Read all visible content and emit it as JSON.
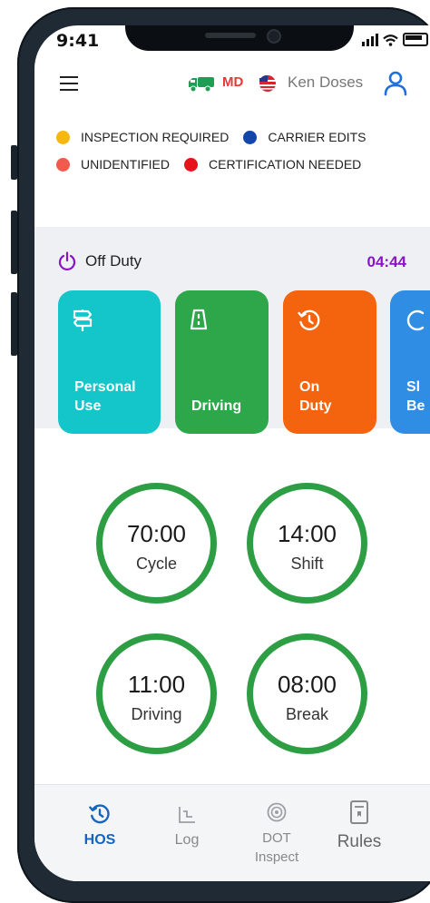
{
  "status_bar": {
    "time": "9:41"
  },
  "header": {
    "jurisdiction": "MD",
    "driver_name": "Ken Doses"
  },
  "legend": [
    {
      "label": "INSPECTION REQUIRED",
      "color": "#f6b80e"
    },
    {
      "label": "CARRIER EDITS",
      "color": "#1346a8"
    },
    {
      "label": "UNIDENTIFIED",
      "color": "#f25a4e"
    },
    {
      "label": "CERTIFICATION NEEDED",
      "color": "#e8121a"
    }
  ],
  "duty": {
    "status": "Off Duty",
    "timer": "04:44",
    "accent": "#8a12c8"
  },
  "duty_buttons": [
    {
      "line1": "Personal",
      "line2": "Use",
      "color": "#14c6c9",
      "icon": "signpost-icon"
    },
    {
      "line1": "",
      "line2": "Driving",
      "color": "#2ea74a",
      "icon": "road-icon"
    },
    {
      "line1": "On",
      "line2": "Duty",
      "color": "#f4640e",
      "icon": "clock-rotate-icon"
    },
    {
      "line1": "Sl",
      "line2": "Be",
      "color": "#2f8de4",
      "icon": "moon-icon"
    }
  ],
  "hos_clocks": [
    {
      "value": "70:00",
      "label": "Cycle"
    },
    {
      "value": "14:00",
      "label": "Shift"
    },
    {
      "value": "11:00",
      "label": "Driving"
    },
    {
      "value": "08:00",
      "label": "Break"
    }
  ],
  "ring_color": "#2e9e45",
  "nav": [
    {
      "label": "HOS",
      "icon": "clock-rotate-icon",
      "active": true
    },
    {
      "label": "Log",
      "icon": "log-chart-icon",
      "active": false
    },
    {
      "label": "DOT\nInspect",
      "icon": "dot-badge-icon",
      "active": false
    },
    {
      "label": "Rules",
      "icon": "rulebook-icon",
      "active": false
    }
  ],
  "nav_active_color": "#1565c0"
}
